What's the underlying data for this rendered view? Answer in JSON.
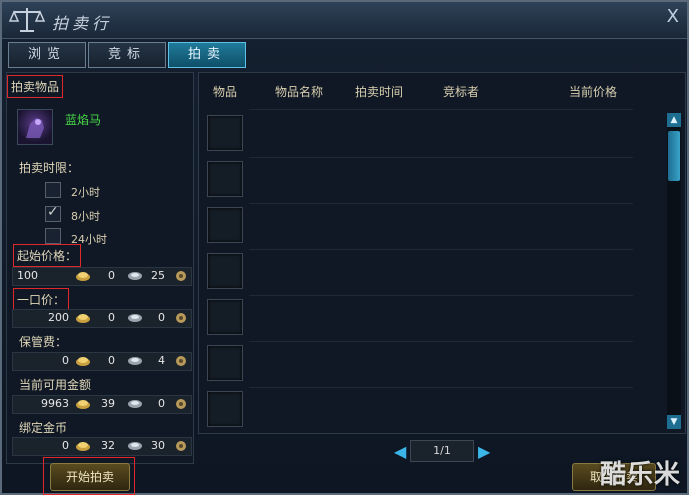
{
  "window": {
    "title": "拍卖行",
    "close": "X"
  },
  "tabs": [
    {
      "label": "浏览",
      "active": false
    },
    {
      "label": "竞标",
      "active": false
    },
    {
      "label": "拍卖",
      "active": true
    }
  ],
  "left": {
    "section_title": "拍卖物品",
    "item_name": "蓝焰马",
    "time_limit_label": "拍卖时限：",
    "time_options": [
      {
        "label": "2小时",
        "checked": false
      },
      {
        "label": "8小时",
        "checked": true
      },
      {
        "label": "24小时",
        "checked": false
      }
    ],
    "start_price_label": "起始价格：",
    "start_price": {
      "gold": "100",
      "silver": "0",
      "copper": "25"
    },
    "buyout_label": "一口价：",
    "buyout": {
      "gold": "200",
      "silver": "0",
      "copper": "0"
    },
    "deposit_label": "保管费：",
    "deposit": {
      "gold": "0",
      "silver": "0",
      "copper": "4"
    },
    "available_label": "当前可用金额",
    "available": {
      "gold": "9963",
      "silver": "39",
      "copper": "0"
    },
    "bound_label": "绑定金币",
    "bound": {
      "gold": "0",
      "silver": "32",
      "copper": "30"
    },
    "start_button": "开始拍卖"
  },
  "table": {
    "columns": [
      "物品",
      "物品名称",
      "拍卖时间",
      "竞标者",
      "当前价格"
    ],
    "rows": 7
  },
  "pager": {
    "text": "1/1",
    "prev": "◀",
    "next": "▶"
  },
  "cancel_button": "取消拍卖",
  "watermark": "酷乐米",
  "colors": {
    "accent": "#1f7b9a",
    "item_name": "#48d848",
    "highlight": "#e0282a"
  }
}
